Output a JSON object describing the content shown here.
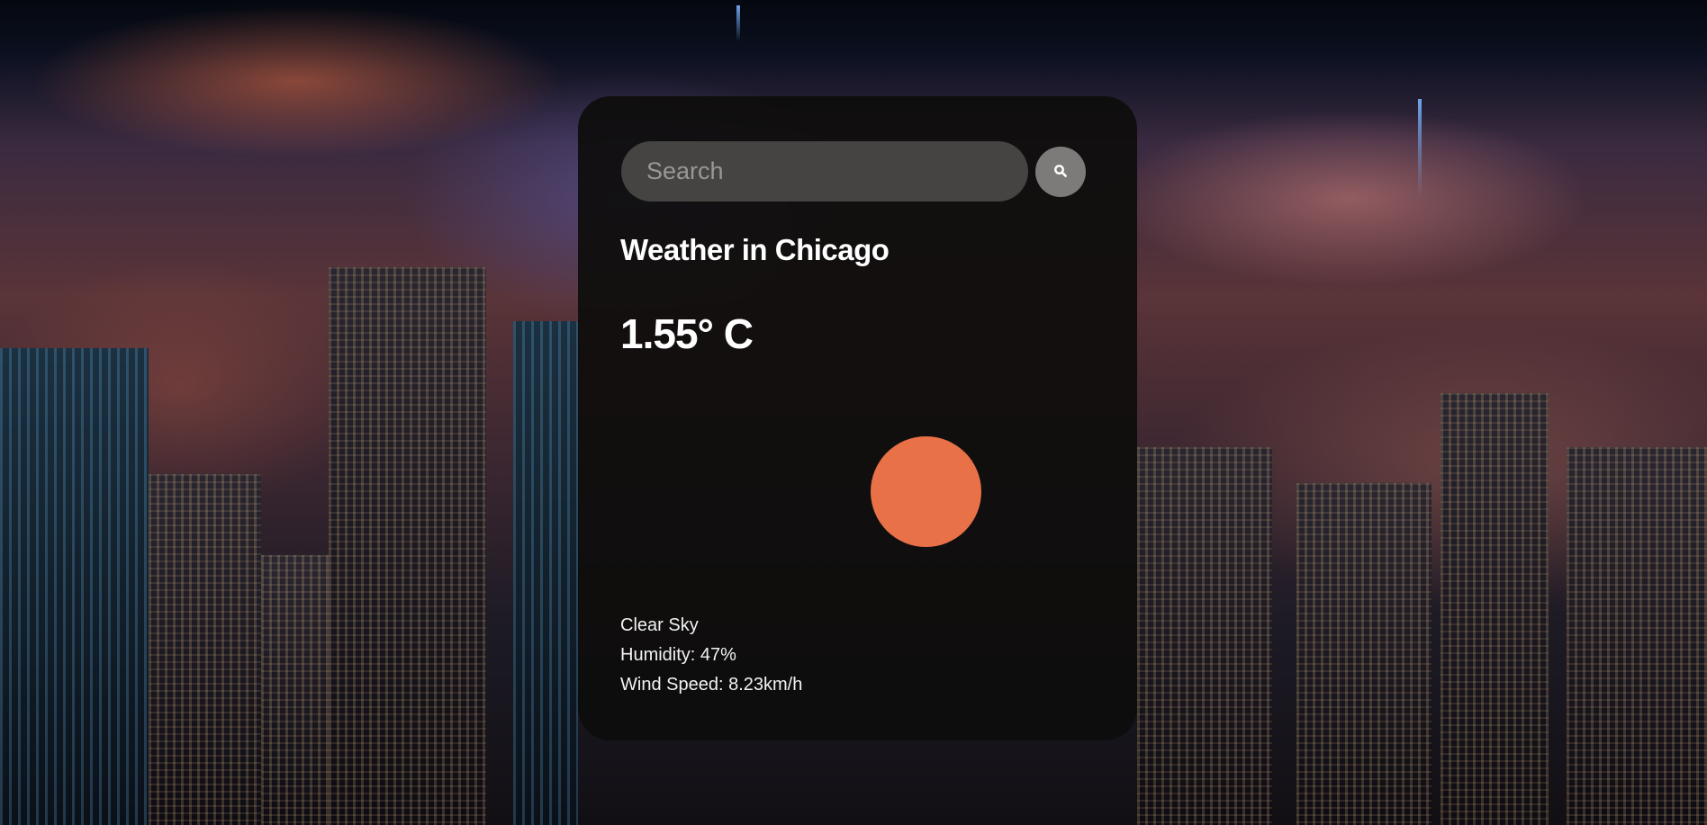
{
  "search": {
    "placeholder": "Search",
    "value": ""
  },
  "weather": {
    "title": "Weather in Chicago",
    "temperature": "1.55° C",
    "description": "Clear Sky",
    "humidity": "Humidity: 47%",
    "wind_speed": "Wind Speed: 8.23km/h"
  },
  "icons": {
    "search": "search-icon",
    "weather": "sun-icon"
  },
  "colors": {
    "card_background": "#0e0d0c",
    "search_field": "#454442",
    "search_button": "#7c7b79",
    "sun": "#e87148",
    "text": "#ffffff"
  }
}
